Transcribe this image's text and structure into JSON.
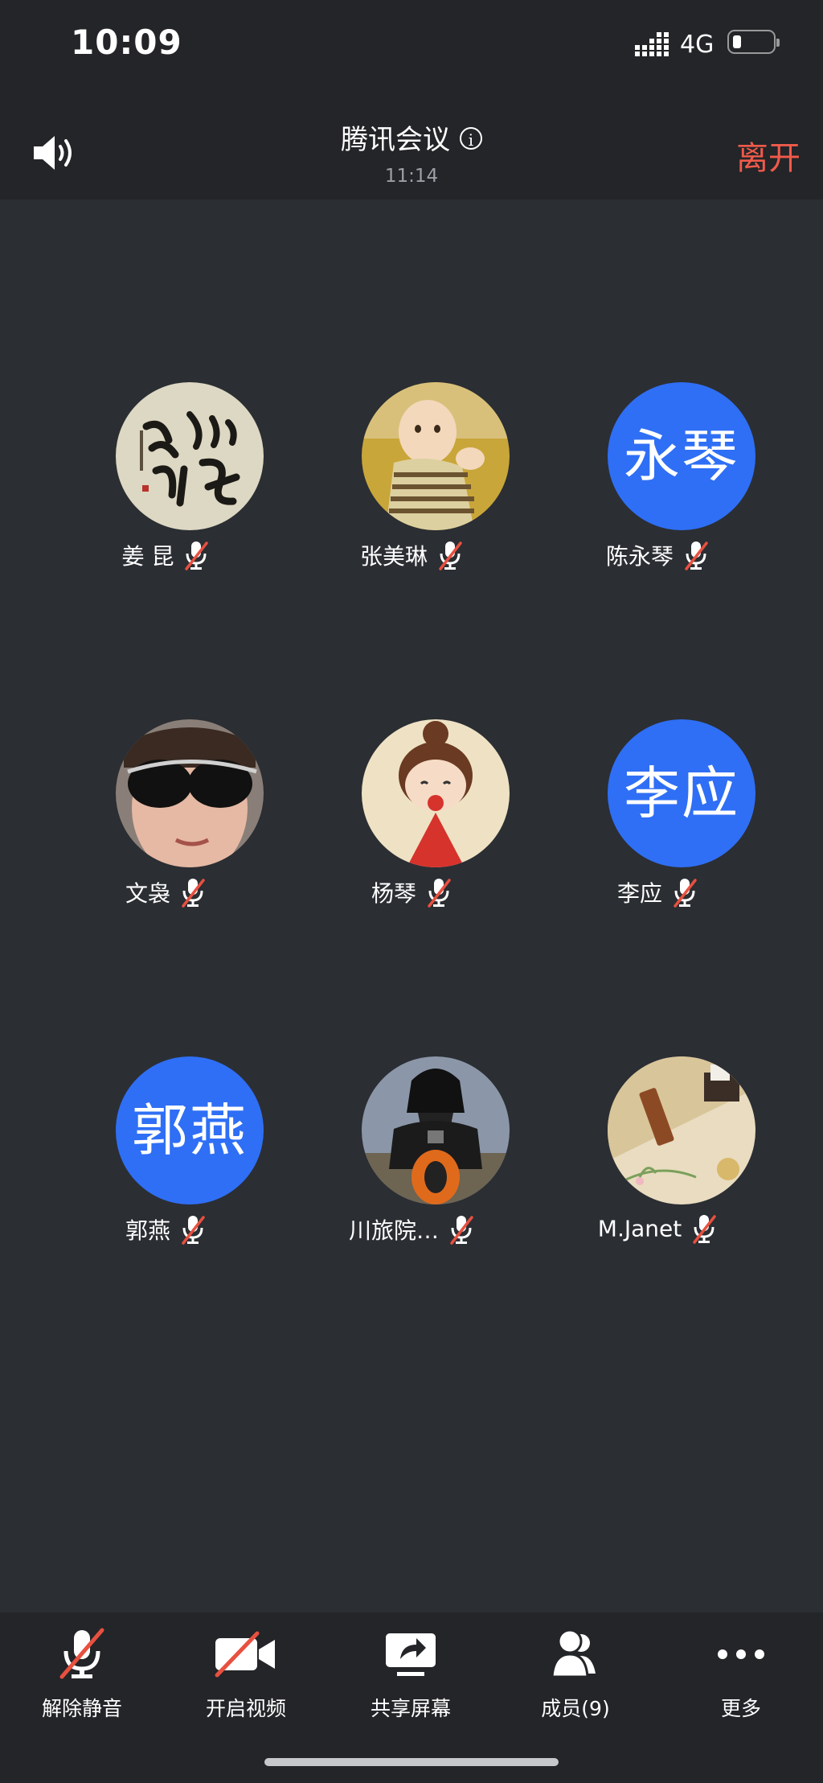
{
  "status_bar": {
    "time": "10:09",
    "network": "4G"
  },
  "header": {
    "title": "腾讯会议",
    "timer": "11:14",
    "leave_label": "离开"
  },
  "participants": [
    {
      "name": "姜 昆",
      "avatar_text": "",
      "avatar_type": "calligraphy"
    },
    {
      "name": "张美琳",
      "avatar_text": "",
      "avatar_type": "baby-photo"
    },
    {
      "name": "陈永琴",
      "avatar_text": "永琴",
      "avatar_type": "initials"
    },
    {
      "name": "文袅",
      "avatar_text": "",
      "avatar_type": "sunglasses-photo"
    },
    {
      "name": "杨琴",
      "avatar_text": "",
      "avatar_type": "cartoon-girl"
    },
    {
      "name": "李应",
      "avatar_text": "李应",
      "avatar_type": "initials"
    },
    {
      "name": "郭燕",
      "avatar_text": "郭燕",
      "avatar_type": "initials"
    },
    {
      "name": "川旅院…",
      "avatar_text": "",
      "avatar_type": "darth-vader-motorcycle"
    },
    {
      "name": "M.Janet",
      "avatar_text": "",
      "avatar_type": "tea-table"
    }
  ],
  "toolbar": {
    "unmute_label": "解除静音",
    "video_label": "开启视频",
    "share_label": "共享屏幕",
    "members_label": "成员(9)",
    "more_label": "更多"
  },
  "colors": {
    "initials_avatar": "#2f6ff5",
    "leave": "#f05a4a",
    "mute_slash": "#e8503f"
  }
}
